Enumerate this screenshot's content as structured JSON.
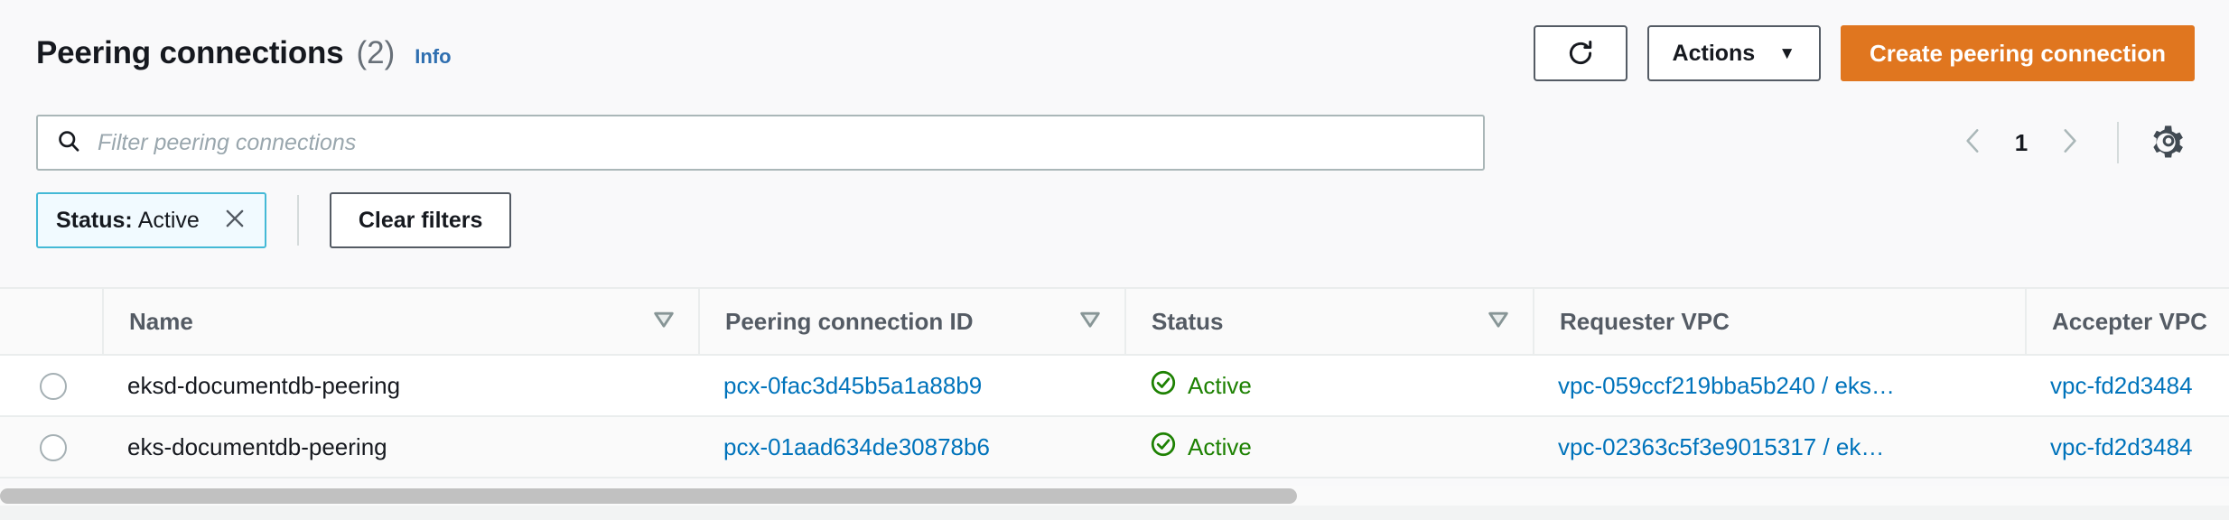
{
  "header": {
    "title": "Peering connections",
    "count": "(2)",
    "info_label": "Info",
    "refresh_icon": "refresh-icon",
    "actions_label": "Actions",
    "actions_caret": "▼",
    "create_label": "Create peering connection",
    "primary_color": "#e0761f",
    "link_color": "#2f6fb0"
  },
  "search": {
    "icon": "search-icon",
    "placeholder": "Filter peering connections",
    "value": ""
  },
  "pagination": {
    "prev_icon": "chevron-left-icon",
    "page": "1",
    "next_icon": "chevron-right-icon",
    "settings_icon": "gear-icon"
  },
  "filters": {
    "chip": {
      "label": "Status:",
      "value": "Active",
      "remove_icon": "close-icon",
      "border_color": "#44b9d6",
      "background_color": "#f1faff"
    },
    "clear_label": "Clear filters"
  },
  "table": {
    "columns": [
      {
        "label": "Name",
        "sortable": true
      },
      {
        "label": "Peering connection ID",
        "sortable": true
      },
      {
        "label": "Status",
        "sortable": true
      },
      {
        "label": "Requester VPC",
        "sortable": false
      },
      {
        "label": "Accepter VPC",
        "sortable": false
      }
    ],
    "rows": [
      {
        "name": "eksd-documentdb-peering",
        "pcx_id": "pcx-0fac3d45b5a1a88b9",
        "status": "Active",
        "status_icon": "check-circle-icon",
        "status_color": "#1d8102",
        "requester_vpc": "vpc-059ccf219bba5b240 / eks…",
        "accepter_vpc": "vpc-fd2d3484"
      },
      {
        "name": "eks-documentdb-peering",
        "pcx_id": "pcx-01aad634de30878b6",
        "status": "Active",
        "status_icon": "check-circle-icon",
        "status_color": "#1d8102",
        "requester_vpc": "vpc-02363c5f3e9015317 / ek…",
        "accepter_vpc": "vpc-fd2d3484"
      }
    ]
  }
}
